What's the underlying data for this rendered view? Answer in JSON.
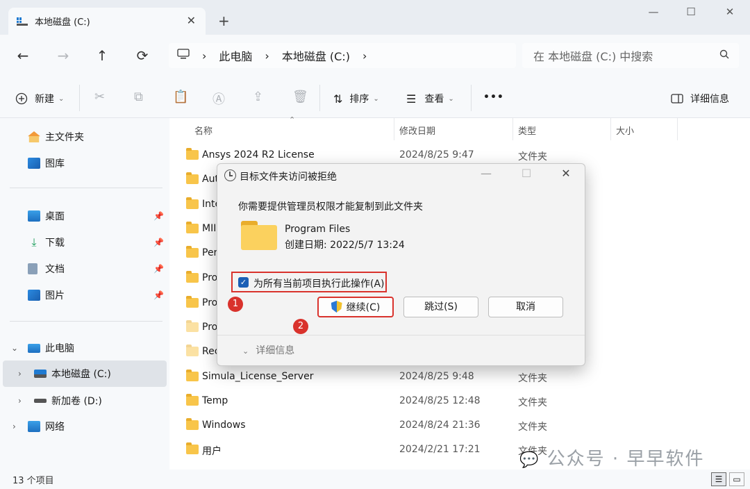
{
  "window": {
    "tab_title": "本地磁盘 (C:)",
    "tab_close": "✕",
    "new_tab": "+",
    "controls": [
      "—",
      "☐",
      "✕"
    ]
  },
  "nav": {
    "back": "←",
    "forward": "→",
    "up": "↑",
    "refresh": "⟳",
    "breadcrumb": [
      "此电脑",
      "本地磁盘 (C:)"
    ],
    "search_placeholder": "在 本地磁盘 (C:) 中搜索"
  },
  "toolbar": {
    "new_label": "新建",
    "sort_label": "排序",
    "view_label": "查看",
    "more_label": "•••",
    "details_label": "详细信息"
  },
  "sidebar": {
    "home": "主文件夹",
    "gallery": "图库",
    "desktop": "桌面",
    "downloads": "下载",
    "documents": "文档",
    "pictures": "图片",
    "this_pc": "此电脑",
    "local_disk": "本地磁盘 (C:)",
    "new_volume": "新加卷 (D:)",
    "network": "网络"
  },
  "columns": {
    "name": "名称",
    "modified": "修改日期",
    "type": "类型",
    "size": "大小"
  },
  "rows": [
    {
      "name": "Ansys 2024 R2 License",
      "date": "2024/8/25 9:47",
      "type": "文件夹"
    },
    {
      "name": "Aut",
      "date": "",
      "type": ""
    },
    {
      "name": "Inte",
      "date": "",
      "type": ""
    },
    {
      "name": "MII",
      "date": "",
      "type": ""
    },
    {
      "name": "Per",
      "date": "",
      "type": ""
    },
    {
      "name": "Pro",
      "date": "",
      "type": ""
    },
    {
      "name": "Pro",
      "date": "",
      "type": ""
    },
    {
      "name": "Pro",
      "date": "",
      "type": ""
    },
    {
      "name": "Rec",
      "date": "",
      "type": ""
    },
    {
      "name": "Simula_License_Server",
      "date": "2024/8/25 9:48",
      "type": "文件夹"
    },
    {
      "name": "Temp",
      "date": "2024/8/25 12:48",
      "type": "文件夹"
    },
    {
      "name": "Windows",
      "date": "2024/8/24 21:36",
      "type": "文件夹"
    },
    {
      "name": "用户",
      "date": "2024/2/21 17:21",
      "type": "文件夹"
    }
  ],
  "status": {
    "count": "13 个项目"
  },
  "watermark": "公众号 · 早早软件",
  "dialog": {
    "title": "目标文件夹访问被拒绝",
    "message": "你需要提供管理员权限才能复制到此文件夹",
    "folder_name": "Program Files",
    "created": "创建日期: 2022/5/7 13:24",
    "checkbox_label": "为所有当前项目执行此操作(A)",
    "continue_label": "继续(C)",
    "skip_label": "跳过(S)",
    "cancel_label": "取消",
    "details_label": "详细信息",
    "badge1": "1",
    "badge2": "2"
  },
  "colors": {
    "accent": "#1b5fb5",
    "highlight": "#d9322c",
    "folder": "#f8c54a"
  }
}
